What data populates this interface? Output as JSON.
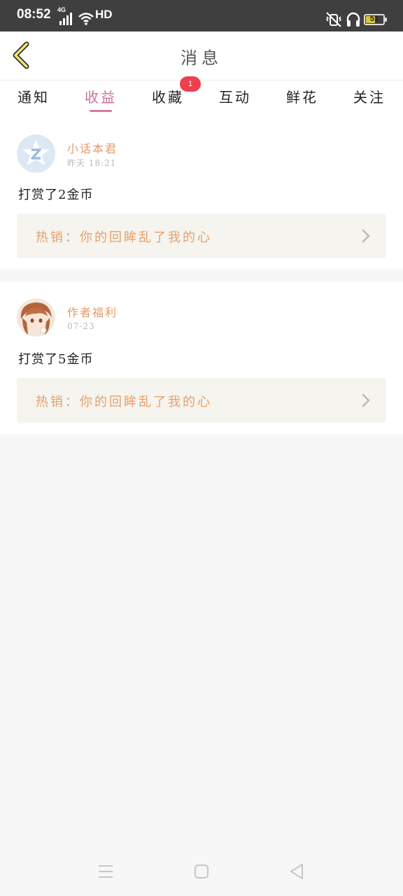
{
  "status_bar": {
    "time": "08:52",
    "network": "4G",
    "hd": "HD",
    "battery": "51",
    "battery_level": 0.51
  },
  "header": {
    "title": "消息"
  },
  "tabs": [
    {
      "label": "通知",
      "active": false
    },
    {
      "label": "收益",
      "active": true
    },
    {
      "label": "收藏",
      "active": false,
      "badge": "1"
    },
    {
      "label": "互动",
      "active": false
    },
    {
      "label": "鲜花",
      "active": false
    },
    {
      "label": "关注",
      "active": false
    }
  ],
  "messages": [
    {
      "sender": "小话本君",
      "time": "昨天 18:21",
      "text": "打赏了2金币",
      "promo": "热销：你的回眸乱了我的心",
      "avatar_icon": "app-logo-icon"
    },
    {
      "sender": "作者福利",
      "time": "07-23",
      "text": "打赏了5金币",
      "promo": "热销：你的回眸乱了我的心",
      "avatar_icon": "anime-girl-avatar"
    }
  ],
  "colors": {
    "accent_pink": "#cf6f9c",
    "sender_orange": "#e59a6a",
    "badge_red": "#ef3f4f",
    "promo_bg": "#f5f4ee"
  }
}
